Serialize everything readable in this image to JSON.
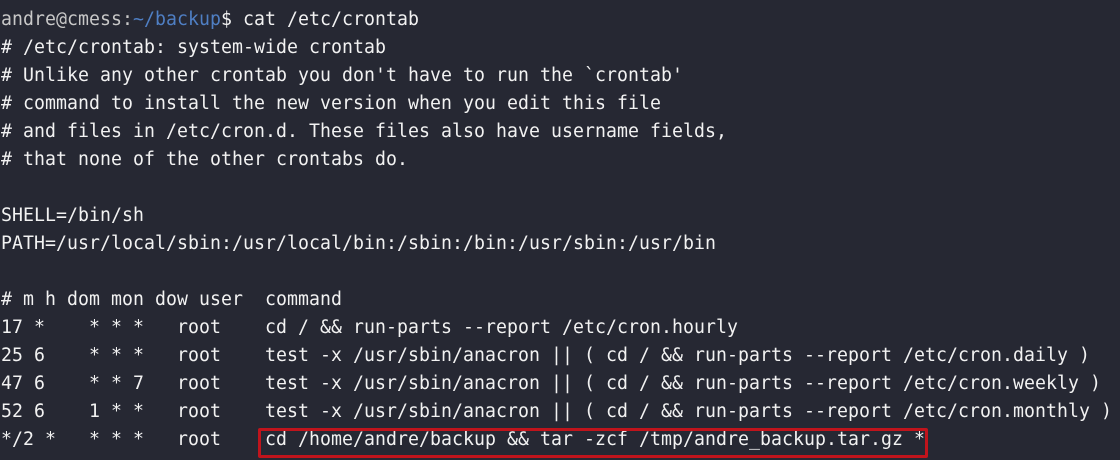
{
  "terminal": {
    "prompt": {
      "user_host": "andre@cmess",
      "separator": ":",
      "path": "~/backup",
      "symbol": "$ ",
      "command": "cat /etc/crontab"
    },
    "lines": [
      "# /etc/crontab: system-wide crontab",
      "# Unlike any other crontab you don't have to run the `crontab'",
      "# command to install the new version when you edit this file",
      "# and files in /etc/cron.d. These files also have username fields,",
      "# that none of the other crontabs do.",
      "",
      "SHELL=/bin/sh",
      "PATH=/usr/local/sbin:/usr/local/bin:/sbin:/bin:/usr/sbin:/usr/bin",
      "",
      "# m h dom mon dow user  command",
      "17 *    * * *   root    cd / && run-parts --report /etc/cron.hourly",
      "25 6    * * *   root    test -x /usr/sbin/anacron || ( cd / && run-parts --report /etc/cron.daily )",
      "47 6    * * 7   root    test -x /usr/sbin/anacron || ( cd / && run-parts --report /etc/cron.weekly )",
      "52 6    1 * *   root    test -x /usr/sbin/anacron || ( cd / && run-parts --report /etc/cron.monthly )"
    ],
    "last_line_prefix": "*/2 *   * * *   root    ",
    "last_line_command": "cd /home/andre/backup && tar -zcf /tmp/andre_backup.tar.gz *"
  }
}
